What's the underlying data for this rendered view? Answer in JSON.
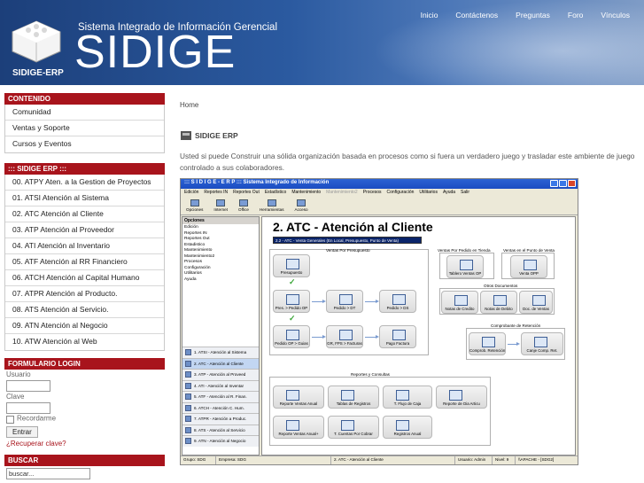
{
  "header": {
    "nav": [
      "Inicio",
      "Contáctenos",
      "Preguntas",
      "Foro",
      "Vínculos"
    ],
    "tagline": "Sistema Integrado de Información Gerencial",
    "brand": "SIDIGE",
    "logo_text": "SIDIGE-ERP"
  },
  "sidebar": {
    "contenido": {
      "title": "CONTENIDO",
      "items": [
        "Comunidad",
        "Ventas y Soporte",
        "Cursos y Eventos"
      ]
    },
    "sidige": {
      "title": "::: SIDIGE ERP :::",
      "items": [
        "00. ATPY Aten. a la Gestion de Proyectos",
        "01. ATSI Atención al Sistema",
        "02. ATC Atención al Cliente",
        "03. ATP Atención al Proveedor",
        "04. ATI Atención al Inventario",
        "05. ATF Atención al RR Financiero",
        "06. ATCH Atención al Capital Humano",
        "07. ATPR Atención al Producto.",
        "08. ATS Atención al Servicio.",
        "09. ATN Atención al Negocio",
        "10. ATW Atención al Web"
      ]
    },
    "login": {
      "title": "FORMULARIO LOGIN",
      "user_label": "Usuario",
      "pass_label": "Clave",
      "remember": "Recordarme",
      "submit": "Entrar",
      "forgot": "¿Recuperar clave?"
    },
    "search": {
      "title": "BUSCAR",
      "placeholder": "buscar..."
    }
  },
  "main": {
    "breadcrumb": "Home",
    "title": "SIDIGE ERP",
    "intro": "Usted si puede Construir una sólida organización basada en procesos como si fuera un verdadero juego y trasladar este ambiente de juego controlado a sus colaboradores."
  },
  "app": {
    "window_title": ":::  S I D I G E - E R P  :::  Sistema Integrado de Información",
    "menu": [
      "Edición",
      "Reportes IN",
      "Reportes Out",
      "Estadístico",
      "Mantenimiento",
      "Mantenimiento2",
      "Procesos",
      "Configuración",
      "Utilitarios",
      "Ayuda",
      "Salir"
    ],
    "toolbar": [
      "Opciones",
      "Internet",
      "Office",
      "Herramientas",
      "Acceso"
    ],
    "options_title": "Opciones",
    "tree": [
      "Edición",
      "Reportes IN",
      "Reportes Out",
      "Estadistico",
      "Mantenimiento",
      "Mantenimiento2",
      "Procesos",
      "Configuración",
      "Utilitarios",
      "Ayuda"
    ],
    "modules": [
      "1. ATSI - Atención al Sistema",
      "2. ATC - Atención al Cliente",
      "3. ATP - Atención al Proveed",
      "4. ATI - Atención al Inventar",
      "5. ATF - Atención al R. Finan.",
      "6. ATCH - Atención C. Hum.",
      "7. ATPR - Atención a Produc.",
      "8. ATS - Atención al Servicio",
      "9. ATN - Atención al Negocio"
    ],
    "canvas_title": "2. ATC - Atención al Cliente",
    "select_value": "2.2 - ATC - Venta Generales (En Local, Presupuesto, Punto de Venta)",
    "sections": {
      "presupuesto": "Ventas Por Presupuesto",
      "pedido_tienda": "Ventas Por Pedido en Tienda",
      "punto_venta": "Ventas en el Punto de Venta",
      "otros_docs": "Otros Documentos",
      "retencion": "Comprobante de Retención",
      "reportes": "Reportes y Consultas"
    },
    "nodes": {
      "presupuesto": "Presupuesto",
      "pres_pedido": "Pres. > Pedido OP",
      "pedido_dt": "Pedido > DT",
      "pedido_ds": "Pedido > DS",
      "pedido_guias": "Pedido OP > Guias",
      "gr_fps": "GR, FPS > Facturas",
      "pago_factura": "Pago Factura",
      "tablero_op": "Tablero Ventas OP",
      "venta_opp": "Venta OPP",
      "notas_credito": "Notas de Credito",
      "notas_debito": "Notas de Debito",
      "doc_ventas": "Doc. de Ventas",
      "comprob_ret": "Comprob. Retención",
      "canje": "Canje Comp. Ret.",
      "rep_anual": "Reporte Ventas Anual",
      "tablas_reg": "Tablas de Registros",
      "flujo_caja": "T. Flujo de Caja",
      "rep_dia": "Reporte de Dia Articu",
      "rep_anual_plus": "Reporte Ventas Anual+",
      "cuentas_cobrar": "T. Cuentas Por Cobrar",
      "registros_anual": "Registros Anual"
    },
    "status": [
      "Grupo: SDG",
      "Empresa: SDG",
      "2. ATC - Atención al Cliente",
      "Usuario: Admin",
      "Nivel: 9",
      "\\\\APACHE - [SDG2]"
    ]
  },
  "colors": {
    "header_blue": "#1c3f7a",
    "accent_red": "#a8141c"
  }
}
